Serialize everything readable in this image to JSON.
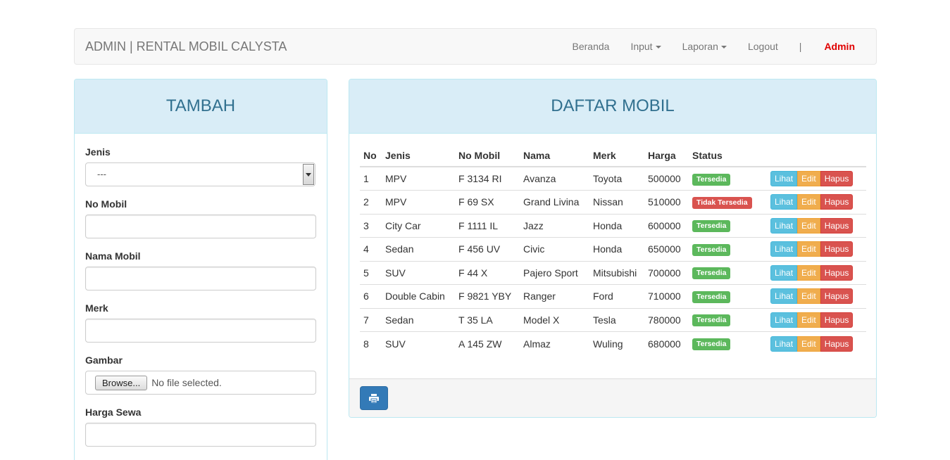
{
  "navbar": {
    "brand": "ADMIN | RENTAL MOBIL CALYSTA",
    "items": [
      {
        "label": "Beranda",
        "dropdown": false
      },
      {
        "label": "Input",
        "dropdown": true
      },
      {
        "label": "Laporan",
        "dropdown": true
      },
      {
        "label": "Logout",
        "dropdown": false
      }
    ],
    "separator": "|",
    "user": "Admin",
    "user_color": "#e00000"
  },
  "left_panel": {
    "title": "TAMBAH",
    "fields": {
      "jenis": {
        "label": "Jenis",
        "selected": "---"
      },
      "no_mobil": {
        "label": "No Mobil",
        "value": ""
      },
      "nama_mobil": {
        "label": "Nama Mobil",
        "value": ""
      },
      "merk": {
        "label": "Merk",
        "value": ""
      },
      "gambar": {
        "label": "Gambar",
        "button": "Browse...",
        "status": "No file selected."
      },
      "harga_sewa": {
        "label": "Harga Sewa",
        "value": ""
      }
    }
  },
  "right_panel": {
    "title": "DAFTAR MOBIL",
    "columns": [
      "No",
      "Jenis",
      "No Mobil",
      "Nama",
      "Merk",
      "Harga",
      "Status",
      ""
    ],
    "actions": {
      "view": "Lihat",
      "edit": "Edit",
      "delete": "Hapus"
    },
    "rows": [
      {
        "no": "1",
        "jenis": "MPV",
        "no_mobil": "F 3134 RI",
        "nama": "Avanza",
        "merk": "Toyota",
        "harga": "500000",
        "status": "Tersedia",
        "available": true
      },
      {
        "no": "2",
        "jenis": "MPV",
        "no_mobil": "F 69 SX",
        "nama": "Grand Livina",
        "merk": "Nissan",
        "harga": "510000",
        "status": "Tidak Tersedia",
        "available": false
      },
      {
        "no": "3",
        "jenis": "City Car",
        "no_mobil": "F 1111 IL",
        "nama": "Jazz",
        "merk": "Honda",
        "harga": "600000",
        "status": "Tersedia",
        "available": true
      },
      {
        "no": "4",
        "jenis": "Sedan",
        "no_mobil": "F 456 UV",
        "nama": "Civic",
        "merk": "Honda",
        "harga": "650000",
        "status": "Tersedia",
        "available": true
      },
      {
        "no": "5",
        "jenis": "SUV",
        "no_mobil": "F 44 X",
        "nama": "Pajero Sport",
        "merk": "Mitsubishi",
        "harga": "700000",
        "status": "Tersedia",
        "available": true
      },
      {
        "no": "6",
        "jenis": "Double Cabin",
        "no_mobil": "F 9821 YBY",
        "nama": "Ranger",
        "merk": "Ford",
        "harga": "710000",
        "status": "Tersedia",
        "available": true
      },
      {
        "no": "7",
        "jenis": "Sedan",
        "no_mobil": "T 35 LA",
        "nama": "Model X",
        "merk": "Tesla",
        "harga": "780000",
        "status": "Tersedia",
        "available": true
      },
      {
        "no": "8",
        "jenis": "SUV",
        "no_mobil": "A 145 ZW",
        "nama": "Almaz",
        "merk": "Wuling",
        "harga": "680000",
        "status": "Tersedia",
        "available": true
      }
    ],
    "footer": {
      "print_icon": "print-icon"
    }
  },
  "colors": {
    "panel_heading_bg": "#d9edf7",
    "panel_title": "#31708f",
    "success": "#5cb85c",
    "danger": "#d9534f",
    "info": "#5bc0de",
    "warning": "#f0ad4e",
    "primary": "#337ab7"
  }
}
